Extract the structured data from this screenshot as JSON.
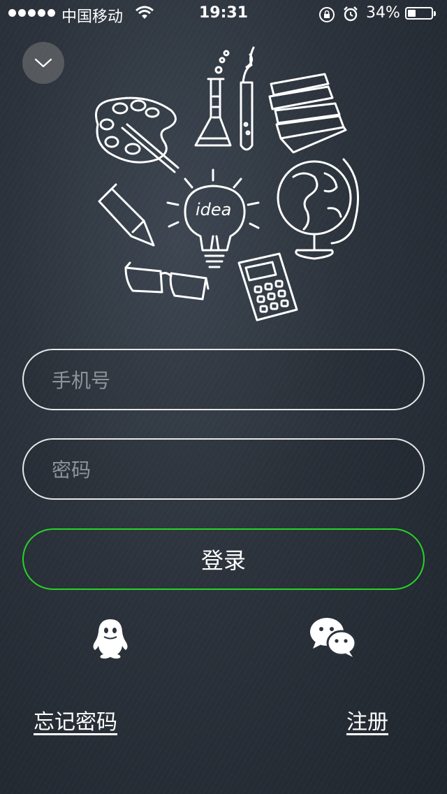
{
  "status_bar": {
    "carrier": "中国移动",
    "time": "19:31",
    "battery_percent": "34%",
    "battery_level": 0.34,
    "icons": [
      "signal-dots-icon",
      "wifi-icon",
      "rotation-lock-icon",
      "alarm-icon",
      "battery-icon"
    ]
  },
  "header": {
    "collapse_icon": "chevron-down-icon"
  },
  "hero": {
    "illustration_items": [
      "palette",
      "flask",
      "test-tube",
      "books",
      "pencil",
      "lightbulb",
      "globe",
      "glasses",
      "calculator"
    ],
    "bulb_text": "idea"
  },
  "form": {
    "phone_placeholder": "手机号",
    "phone_value": "",
    "password_placeholder": "密码",
    "password_value": "",
    "login_label": "登录"
  },
  "social": {
    "qq_icon": "qq-icon",
    "wechat_icon": "wechat-icon"
  },
  "links": {
    "forgot_password": "忘记密码",
    "register": "注册"
  },
  "colors": {
    "background": "#2b323b",
    "field_border": "#e8e8e8",
    "login_border": "#27d427",
    "placeholder": "#8e949b"
  }
}
